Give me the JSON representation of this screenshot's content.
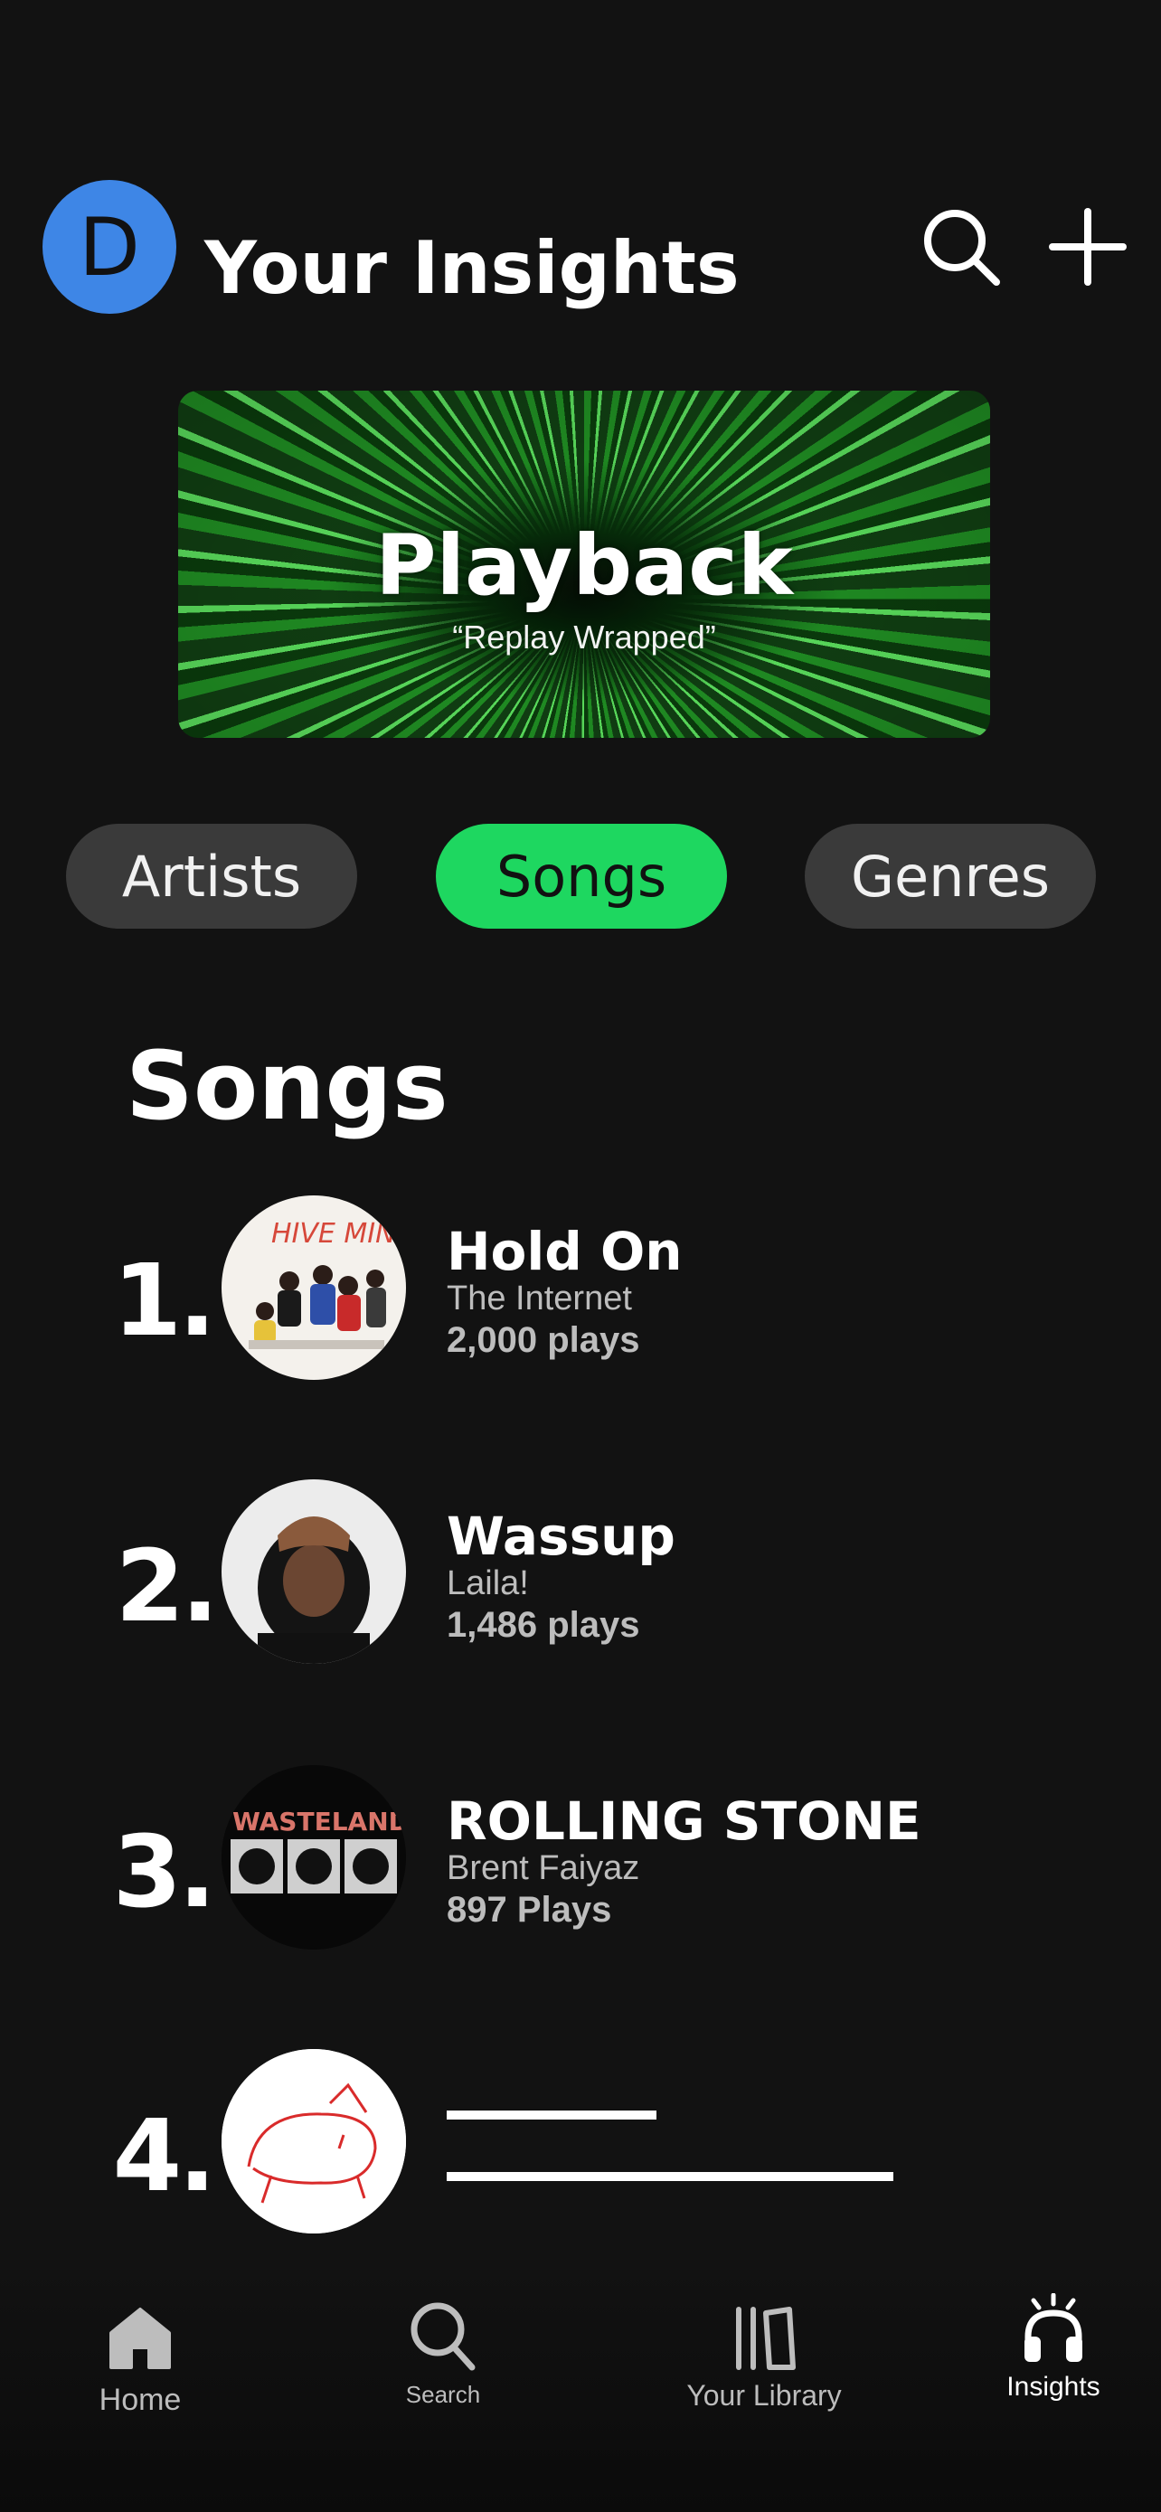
{
  "header": {
    "avatar_initial": "D",
    "title": "Your Insights",
    "search_icon": "search-icon",
    "add_icon": "plus-icon"
  },
  "banner": {
    "title": "Playback",
    "subtitle": "“Replay Wrapped”"
  },
  "filters": [
    {
      "label": "Artists",
      "active": false
    },
    {
      "label": "Songs",
      "active": true
    },
    {
      "label": "Genres",
      "active": false
    }
  ],
  "section": {
    "title": "Songs"
  },
  "songs": [
    {
      "rank": "1.",
      "title": "Hold On",
      "artist": "The Internet",
      "plays": "2,000 plays"
    },
    {
      "rank": "2.",
      "title": "Wassup",
      "artist": "Laila!",
      "plays": "1,486 plays"
    },
    {
      "rank": "3.",
      "title": "ROLLING STONE",
      "artist": "Brent Faiyaz",
      "plays": "897 Plays"
    },
    {
      "rank": "4.",
      "title": "",
      "artist": "",
      "plays": ""
    }
  ],
  "album_art_text": {
    "song1": "HIVE MIND",
    "song3": "WASTELAND"
  },
  "tabbar": [
    {
      "label": "Home",
      "icon": "home-icon",
      "active": false
    },
    {
      "label": "Search",
      "icon": "search-icon",
      "active": false
    },
    {
      "label": "Your Library",
      "icon": "library-icon",
      "active": false
    },
    {
      "label": "Insights",
      "icon": "headphones-icon",
      "active": true
    }
  ],
  "colors": {
    "accent": "#1ed760",
    "avatar": "#3e86e6",
    "background": "#121212",
    "pill": "#3a3a3a"
  }
}
